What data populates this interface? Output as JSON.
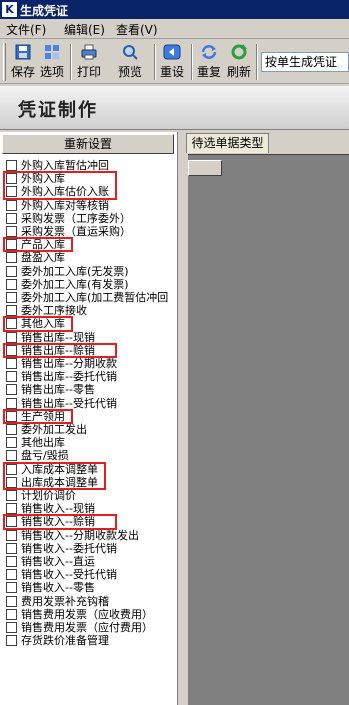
{
  "window": {
    "title": "生成凭证",
    "icon": "kingdee-logo-icon"
  },
  "menu": [
    {
      "label": "文件(F)"
    },
    {
      "label": "编辑(E)"
    },
    {
      "label": "查看(V)"
    }
  ],
  "toolbar": {
    "buttons": [
      {
        "label": "保存",
        "icon": "save-icon"
      },
      {
        "label": "选项",
        "icon": "options-icon"
      },
      {
        "label": "打印",
        "icon": "print-icon"
      },
      {
        "label": "预览",
        "icon": "preview-icon"
      },
      {
        "label": "重设",
        "icon": "reset-icon"
      },
      {
        "label": "重复",
        "icon": "repeat-icon"
      },
      {
        "label": "刷新",
        "icon": "refresh-icon"
      }
    ],
    "mode": "按单生成凭证"
  },
  "header": {
    "title": "凭证制作"
  },
  "left": {
    "regen_label": "重新设置",
    "items": [
      {
        "label": "外购入库暂估冲回",
        "checked": false,
        "highlight": false
      },
      {
        "label": "外购入库",
        "checked": false,
        "highlight": true
      },
      {
        "label": "外购入库估价入账",
        "checked": false,
        "highlight": true
      },
      {
        "label": "外购入库对等核销",
        "checked": false,
        "highlight": false
      },
      {
        "label": "采购发票（工序委外）",
        "checked": false,
        "highlight": false
      },
      {
        "label": "采购发票（直运采购）",
        "checked": false,
        "highlight": false
      },
      {
        "label": "产品入库",
        "checked": false,
        "highlight": true
      },
      {
        "label": "盘盈入库",
        "checked": false,
        "highlight": false
      },
      {
        "label": "委外加工入库(无发票)",
        "checked": false,
        "highlight": false
      },
      {
        "label": "委外加工入库(有发票)",
        "checked": false,
        "highlight": false
      },
      {
        "label": "委外加工入库(加工费暂估冲回",
        "checked": false,
        "highlight": false
      },
      {
        "label": "委外工序接收",
        "checked": false,
        "highlight": false
      },
      {
        "label": "其他入库",
        "checked": false,
        "highlight": true
      },
      {
        "label": "销售出库--现销",
        "checked": false,
        "highlight": false
      },
      {
        "label": "销售出库--赊销",
        "checked": false,
        "highlight": true
      },
      {
        "label": "销售出库--分期收款",
        "checked": false,
        "highlight": false
      },
      {
        "label": "销售出库--委托代销",
        "checked": false,
        "highlight": false
      },
      {
        "label": "销售出库--零售",
        "checked": false,
        "highlight": false
      },
      {
        "label": "销售出库--受托代销",
        "checked": false,
        "highlight": false
      },
      {
        "label": "生产领用",
        "checked": false,
        "highlight": true
      },
      {
        "label": "委外加工发出",
        "checked": false,
        "highlight": false
      },
      {
        "label": "其他出库",
        "checked": false,
        "highlight": false
      },
      {
        "label": "盘亏/毁损",
        "checked": false,
        "highlight": false
      },
      {
        "label": "入库成本调整单",
        "checked": false,
        "highlight": true
      },
      {
        "label": "出库成本调整单",
        "checked": false,
        "highlight": true
      },
      {
        "label": "计划价调价",
        "checked": false,
        "highlight": false
      },
      {
        "label": "销售收入--现销",
        "checked": false,
        "highlight": false
      },
      {
        "label": "销售收入--赊销",
        "checked": false,
        "highlight": true
      },
      {
        "label": "销售收入--分期收款发出",
        "checked": false,
        "highlight": false
      },
      {
        "label": "销售收入--委托代销",
        "checked": false,
        "highlight": false
      },
      {
        "label": "销售收入--直运",
        "checked": false,
        "highlight": false
      },
      {
        "label": "销售收入--受托代销",
        "checked": false,
        "highlight": false
      },
      {
        "label": "销售收入--零售",
        "checked": false,
        "highlight": false
      },
      {
        "label": "费用发票补充钩稽",
        "checked": false,
        "highlight": false
      },
      {
        "label": "销售费用发票（应收费用）",
        "checked": false,
        "highlight": false
      },
      {
        "label": "销售费用发票（应付费用）",
        "checked": false,
        "highlight": false
      },
      {
        "label": "存货跌价准备管理",
        "checked": false,
        "highlight": false
      }
    ]
  },
  "right": {
    "tab_label": "待选单据类型"
  },
  "colors": {
    "title_bg": "#0a246a",
    "highlight": "#e02020",
    "face": "#d4d0c8"
  }
}
